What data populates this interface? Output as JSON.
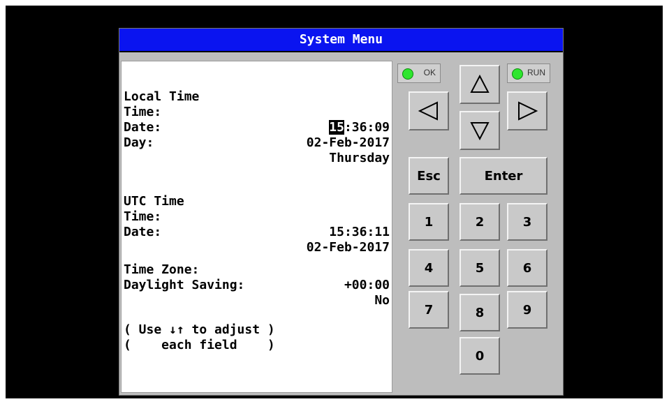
{
  "title": "System Menu",
  "sections": {
    "local": {
      "header": "Local Time",
      "time_label": "Time:",
      "time_hour": "15",
      "time_rest": ":36:09",
      "date_label": "Date:",
      "date_value": "02-Feb-2017",
      "day_label": "Day:",
      "day_value": "Thursday"
    },
    "utc": {
      "header": "UTC Time",
      "time_label": "Time:",
      "time_value": "15:36:11",
      "date_label": "Date:",
      "date_value": "02-Feb-2017"
    },
    "settings": {
      "tz_label": "Time Zone:",
      "tz_value": "+00:00",
      "dst_label": "Daylight Saving:",
      "dst_value": "No"
    },
    "notes": [
      "( Use ↓↑ to adjust )",
      "(    each field    )"
    ]
  },
  "indicators": {
    "ok": "OK",
    "run": "RUN",
    "led_color": "#2ee62e"
  },
  "keypad": {
    "esc": "Esc",
    "enter": "Enter",
    "k1": "1",
    "k2": "2",
    "k3": "3",
    "k4": "4",
    "k5": "5",
    "k6": "6",
    "k7": "7",
    "k8": "8",
    "k9": "9",
    "k0": "0"
  },
  "colors": {
    "titlebar": "#0a14f0",
    "panel": "#bdbdbd"
  }
}
